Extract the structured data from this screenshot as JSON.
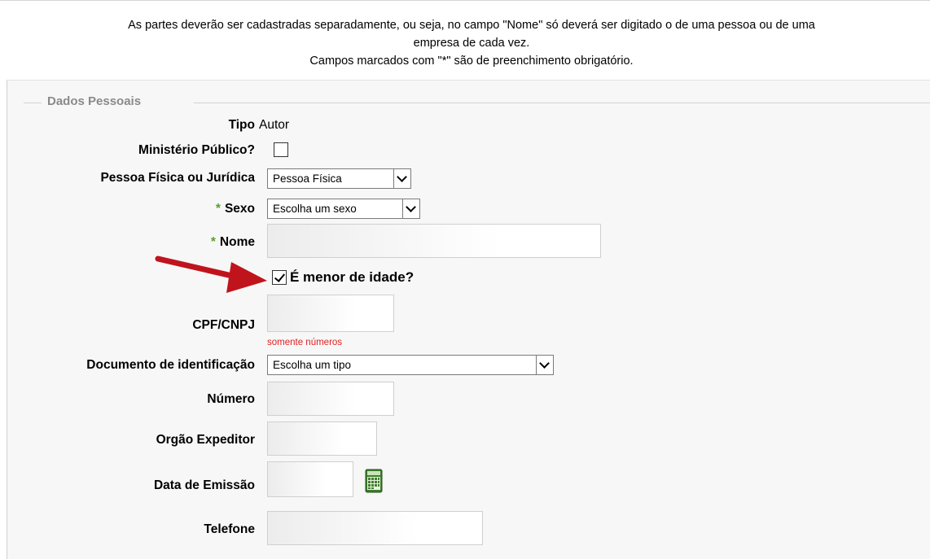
{
  "intro": {
    "line1": "As partes deverão ser cadastradas separadamente, ou seja, no campo \"Nome\" só deverá ser digitado o de uma pessoa ou de uma",
    "line2": "empresa de cada vez.",
    "line3": "Campos marcados com \"*\" são de preenchimento obrigatório."
  },
  "section": {
    "legend": "Dados Pessoais"
  },
  "fields": {
    "tipo": {
      "label": "Tipo",
      "value": "Autor"
    },
    "ministerio": {
      "label": "Ministério Público?",
      "checked": false
    },
    "pessoa": {
      "label": "Pessoa Física ou Jurídica",
      "selected": "Pessoa Física"
    },
    "sexo": {
      "required_mark": "*",
      "label": "Sexo",
      "selected": "Escolha um sexo"
    },
    "nome": {
      "required_mark": "*",
      "label": "Nome",
      "value": ""
    },
    "menor": {
      "label": "É menor de idade?",
      "checked": true
    },
    "cpf": {
      "label": "CPF/CNPJ",
      "value": "",
      "hint": "somente números"
    },
    "documento": {
      "label": "Documento de identificação",
      "selected": "Escolha um tipo"
    },
    "numero": {
      "label": "Número",
      "value": ""
    },
    "orgao": {
      "label": "Orgão Expeditor",
      "value": ""
    },
    "data_emissao": {
      "label": "Data de Emissão",
      "value": "",
      "icon": "calendar-icon"
    },
    "telefone": {
      "label": "Telefone",
      "value": ""
    }
  },
  "annotation": {
    "icon": "red-arrow-pointer",
    "color": "#c0141c"
  },
  "colors": {
    "required": "#5aa02c",
    "hint": "#e02020",
    "legend": "#8a8a8a"
  }
}
